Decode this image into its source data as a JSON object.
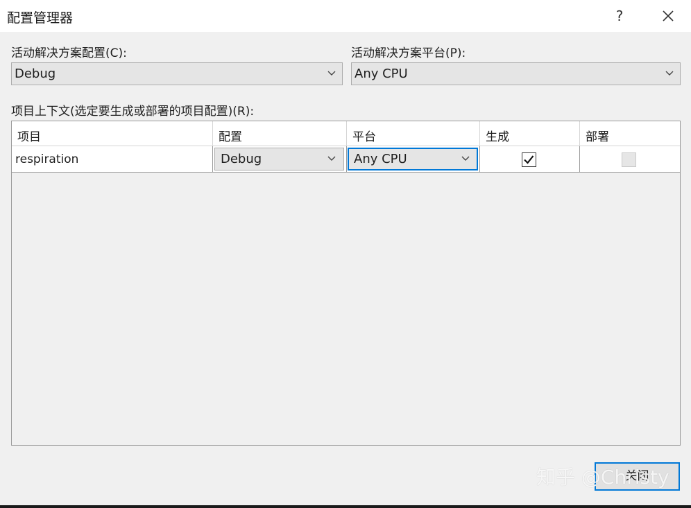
{
  "window": {
    "title": "配置管理器",
    "help_label": "?"
  },
  "active_config": {
    "label": "活动解决方案配置(C):",
    "value": "Debug"
  },
  "active_platform": {
    "label": "活动解决方案平台(P):",
    "value": "Any CPU"
  },
  "project_contexts": {
    "label": "项目上下文(选定要生成或部署的项目配置)(R):",
    "columns": [
      "项目",
      "配置",
      "平台",
      "生成",
      "部署"
    ],
    "rows": [
      {
        "project": "respiration",
        "config": "Debug",
        "platform": "Any CPU",
        "build": true,
        "deploy": false,
        "deploy_enabled": false
      }
    ]
  },
  "footer": {
    "close_label": "关闭"
  },
  "watermark": "知乎 @Christy",
  "colors": {
    "focus_border": "#0078d7",
    "window_bg": "#f0f0f0",
    "combo_bg": "#e5e5e5"
  }
}
